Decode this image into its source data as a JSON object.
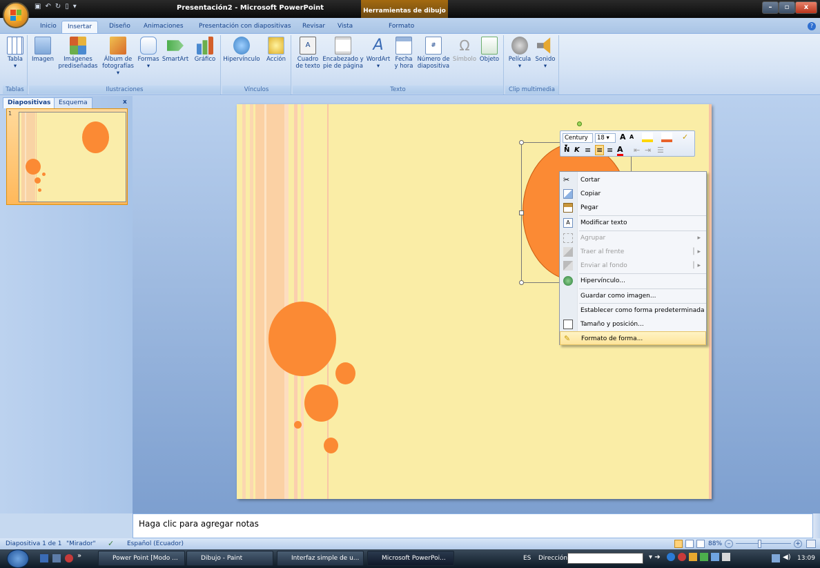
{
  "titlebar": {
    "title": "Presentación2 - Microsoft PowerPoint",
    "contextual_tool": "Herramientas de dibujo"
  },
  "tabs": [
    "Inicio",
    "Insertar",
    "Diseño",
    "Animaciones",
    "Presentación con diapositivas",
    "Revisar",
    "Vista",
    "Formato"
  ],
  "active_tab": "Insertar",
  "ribbon": {
    "groups": [
      {
        "label": "Tablas",
        "buttons": [
          {
            "line1": "Tabla",
            "line2": "▾",
            "icon": "table-icon",
            "color": "#5a82c0"
          }
        ]
      },
      {
        "label": "Ilustraciones",
        "buttons": [
          {
            "line1": "Imagen",
            "line2": "",
            "icon": "picture-icon",
            "color": "#7fa7d8"
          },
          {
            "line1": "Imágenes",
            "line2": "prediseñadas",
            "icon": "clipart-icon",
            "color": "#e8b23a"
          },
          {
            "line1": "Álbum de",
            "line2": "fotografías ▾",
            "icon": "photo-album-icon",
            "color": "#d76a2a"
          },
          {
            "line1": "Formas",
            "line2": "▾",
            "icon": "shapes-icon",
            "color": "#6e9ad4"
          },
          {
            "line1": "SmartArt",
            "line2": "",
            "icon": "smartart-icon",
            "color": "#4cae4c"
          },
          {
            "line1": "Gráfico",
            "line2": "",
            "icon": "chart-icon",
            "color": "#d35f2a"
          }
        ]
      },
      {
        "label": "Vínculos",
        "buttons": [
          {
            "line1": "Hipervínculo",
            "line2": "",
            "icon": "hyperlink-icon",
            "color": "#3a7fc4"
          },
          {
            "line1": "Acción",
            "line2": "",
            "icon": "action-icon",
            "color": "#e0b02a"
          }
        ]
      },
      {
        "label": "Texto",
        "buttons": [
          {
            "line1": "Cuadro",
            "line2": "de texto",
            "icon": "textbox-icon",
            "color": "#f2f2f2"
          },
          {
            "line1": "Encabezado y",
            "line2": "pie de página",
            "icon": "header-footer-icon",
            "color": "#f2f2f2"
          },
          {
            "line1": "WordArt",
            "line2": "▾",
            "icon": "wordart-icon",
            "color": "#3a6bb5"
          },
          {
            "line1": "Fecha",
            "line2": "y hora",
            "icon": "date-time-icon",
            "color": "#9ab6dc"
          },
          {
            "line1": "Número de",
            "line2": "diapositiva",
            "icon": "slide-number-icon",
            "color": "#cfd8e4"
          },
          {
            "line1": "Símbolo",
            "line2": "",
            "icon": "symbol-icon",
            "color": "#b0b0b0"
          },
          {
            "line1": "Objeto",
            "line2": "",
            "icon": "object-icon",
            "color": "#6cae6c"
          }
        ]
      },
      {
        "label": "Clip multimedia",
        "buttons": [
          {
            "line1": "Película",
            "line2": "▾",
            "icon": "movie-icon",
            "color": "#8a8a8a"
          },
          {
            "line1": "Sonido",
            "line2": "▾",
            "icon": "sound-icon",
            "color": "#e6a830"
          }
        ]
      }
    ]
  },
  "left_pane": {
    "tabs": [
      "Diapositivas",
      "Esquema"
    ],
    "close": "x",
    "thumb_number": "1"
  },
  "mini_toolbar": {
    "font": "Century",
    "size": "18",
    "row1_tools": [
      "A",
      "A",
      "⌂",
      "✎",
      "✓"
    ],
    "bold": "N",
    "italic": "K",
    "row2_tools": [
      "≡",
      "≡",
      "≡",
      "A",
      "⇤",
      "⇥",
      "☰"
    ]
  },
  "context_menu": {
    "items": [
      {
        "label": "Cortar",
        "icon": "scissors-icon",
        "disabled": false,
        "submenu": false
      },
      {
        "label": "Copiar",
        "icon": "copy-icon",
        "disabled": false,
        "submenu": false
      },
      {
        "label": "Pegar",
        "icon": "paste-icon",
        "disabled": false,
        "submenu": false
      },
      {
        "label": "Modificar texto",
        "icon": "edit-text-icon",
        "disabled": false,
        "submenu": false
      },
      {
        "label": "Agrupar",
        "icon": "group-icon",
        "disabled": true,
        "submenu": true
      },
      {
        "label": "Traer al frente",
        "icon": "bring-front-icon",
        "disabled": true,
        "submenu": true
      },
      {
        "label": "Enviar al fondo",
        "icon": "send-back-icon",
        "disabled": true,
        "submenu": true
      },
      {
        "label": "Hipervínculo...",
        "icon": "hyperlink-icon",
        "disabled": false,
        "submenu": false
      },
      {
        "label": "Guardar como imagen...",
        "icon": "",
        "disabled": false,
        "submenu": false
      },
      {
        "label": "Establecer como forma predeterminada",
        "icon": "",
        "disabled": false,
        "submenu": false
      },
      {
        "label": "Tamaño y posición...",
        "icon": "size-position-icon",
        "disabled": false,
        "submenu": false
      },
      {
        "label": "Formato de forma...",
        "icon": "format-shape-icon",
        "disabled": false,
        "submenu": false,
        "highlighted": true
      }
    ]
  },
  "notes": {
    "placeholder": "Haga clic para agregar notas"
  },
  "statusbar": {
    "slide": "Diapositiva 1 de 1",
    "theme": "\"Mirador\"",
    "language": "Español (Ecuador)",
    "zoom": "88%"
  },
  "taskbar": {
    "buttons": [
      "Power Point [Modo ...",
      "Dibujo - Paint",
      "Interfaz simple de u...",
      "Microsoft PowerPoi..."
    ],
    "lang": "ES",
    "address_label": "Dirección",
    "time": "13:09"
  },
  "colors": {
    "accent": "#fb8a34",
    "slide_bg": "#faeda6",
    "ribbon": "#d5e3f5"
  }
}
